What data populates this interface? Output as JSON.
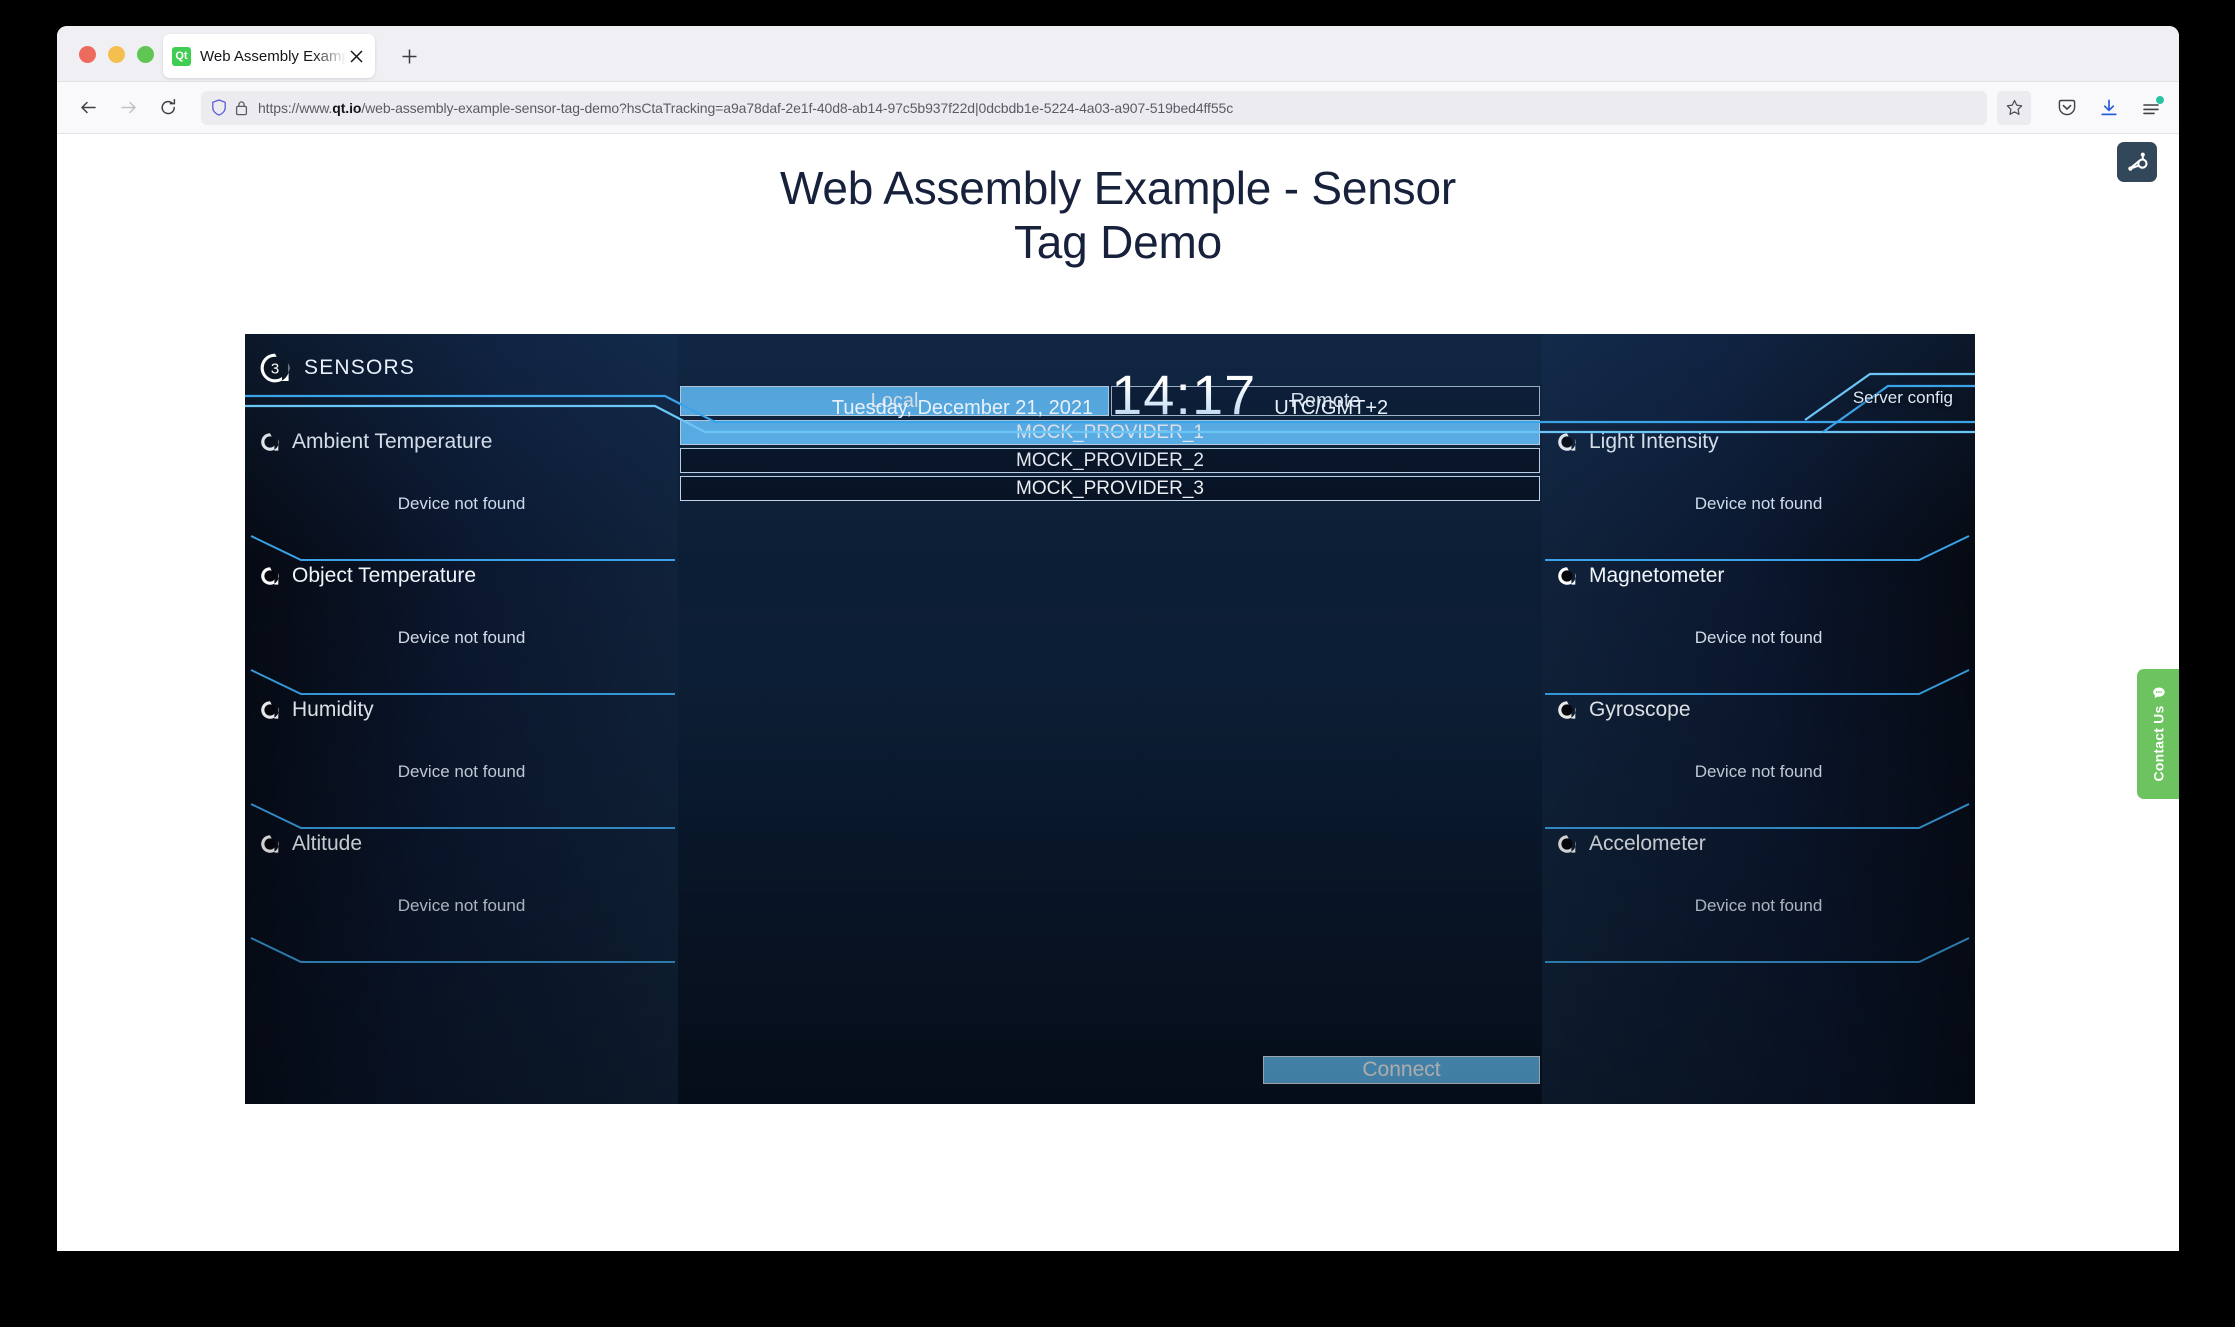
{
  "browser": {
    "tab": {
      "title": "Web Assembly Example - Sensor Tag Demo",
      "favicon_label": "Qt"
    },
    "url": {
      "prefix": "https://www.",
      "domain": "qt.io",
      "rest": "/web-assembly-example-sensor-tag-demo?hsCtaTracking=a9a78daf-2e1f-40d8-ab14-97c5b937f22d|0dcbdb1e-5224-4a03-a907-519bed4ff55c",
      "full": "https://www.qt.io/web-assembly-example-sensor-tag-demo?hsCtaTracking=a9a78daf-2e1f-40d8-ab14-97c5b937f22d|0dcbdb1e-5224-4a03-a907-519bed4ff55c"
    },
    "controls": {
      "back": "Back",
      "forward": "Forward",
      "reload": "Reload",
      "bookmark": "Bookmark this page",
      "pocket": "Save to Pocket",
      "downloads": "Downloads",
      "menu": "Open application menu",
      "new_tab": "New tab",
      "close_tab": "Close tab"
    }
  },
  "page": {
    "title_line1": "Web Assembly Example - Sensor",
    "title_line2": "Tag Demo",
    "contact_tab_label": "Contact Us",
    "hubspot_label": "HubSpot"
  },
  "app": {
    "logo": {
      "badge": "3",
      "text": "SENSORS"
    },
    "clock": {
      "date": "Tuesday, December 21, 2021",
      "time": "14:17",
      "timezone": "UTC/GMT+2"
    },
    "server_config_label": "Server config",
    "dialog": {
      "tabs": [
        {
          "label": "Local",
          "active": true
        },
        {
          "label": "Remote",
          "active": false
        }
      ],
      "providers": [
        {
          "label": "MOCK_PROVIDER_1",
          "selected": true
        },
        {
          "label": "MOCK_PROVIDER_2",
          "selected": false
        },
        {
          "label": "MOCK_PROVIDER_3",
          "selected": false
        }
      ],
      "connect_label": "Connect"
    },
    "status_not_found": "Device not found",
    "sensors_left": [
      {
        "name": "Ambient Temperature",
        "status": "Device not found"
      },
      {
        "name": "Object Temperature",
        "status": "Device not found"
      },
      {
        "name": "Humidity",
        "status": "Device not found"
      },
      {
        "name": "Altitude",
        "status": "Device not found"
      }
    ],
    "sensors_right": [
      {
        "name": "Light Intensity",
        "status": "Device not found"
      },
      {
        "name": "Magnetometer",
        "status": "Device not found"
      },
      {
        "name": "Gyroscope",
        "status": "Device not found"
      },
      {
        "name": "Accelometer",
        "status": "Device not found"
      }
    ]
  },
  "colors": {
    "accent_blue": "#63bdf6",
    "line_blue": "#3ba3e8",
    "qt_green": "#41cd52",
    "contact_green": "#6cc35f",
    "title_navy": "#17213c",
    "app_dark": "#04070f"
  }
}
